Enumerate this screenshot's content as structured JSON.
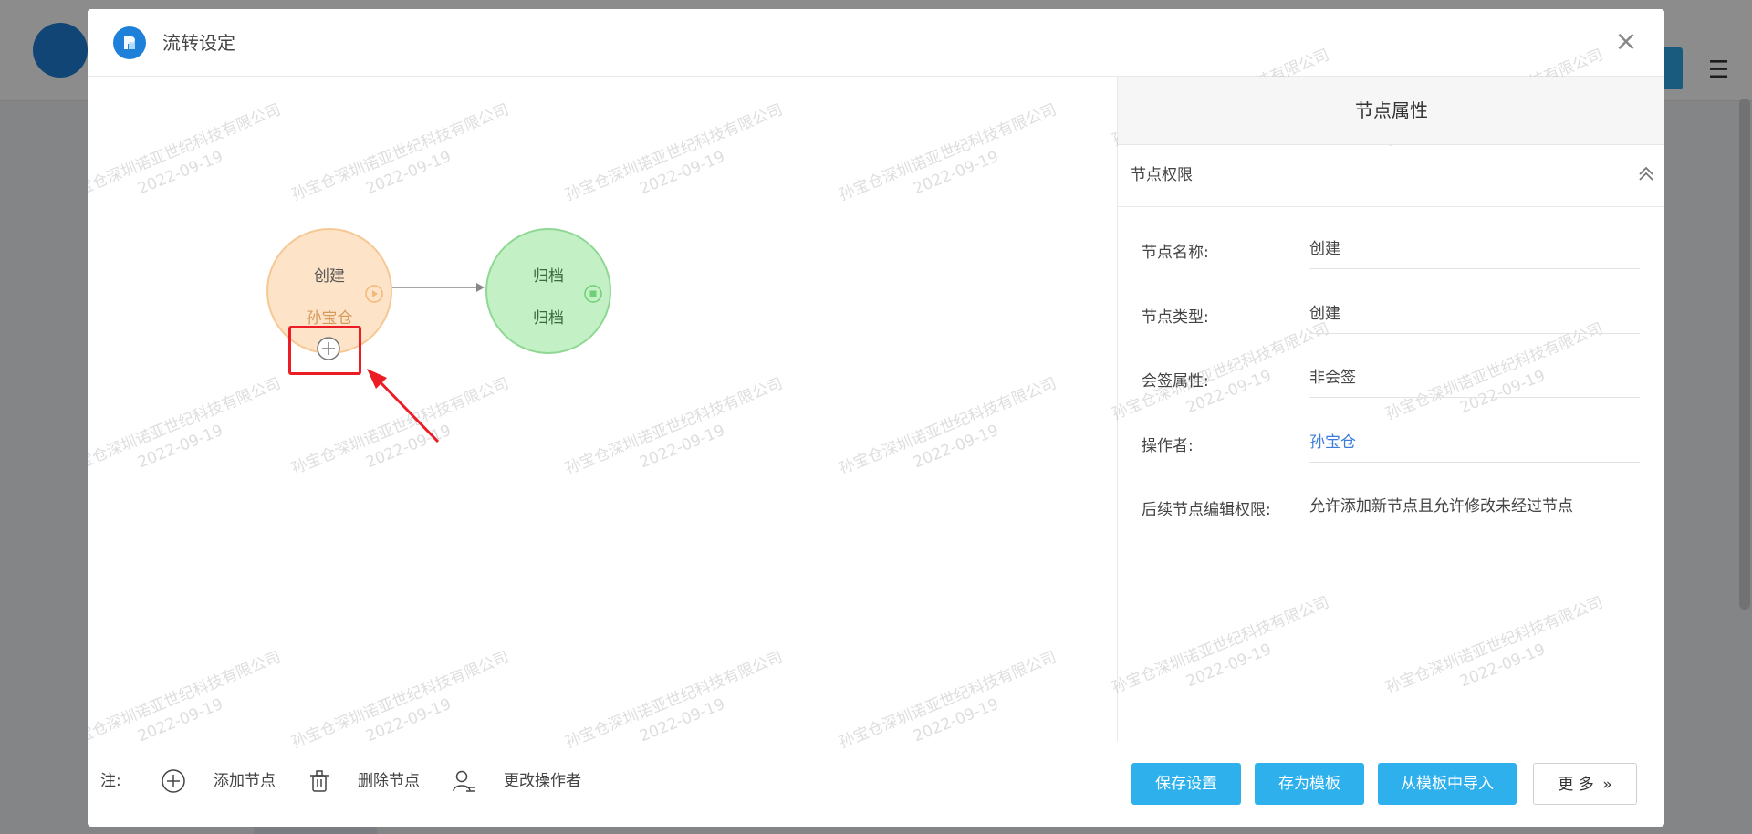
{
  "modal": {
    "title": "流转设定",
    "close_label": "×"
  },
  "watermark": {
    "line1": "孙宝仓深圳诺亚世纪科技有限公司",
    "line2": "2022-09-19"
  },
  "flow": {
    "start_node": {
      "title": "创建",
      "operator": "孙宝仓"
    },
    "end_node": {
      "title": "归档",
      "operator": "归档"
    }
  },
  "legend": {
    "note_label": "注:",
    "add_node": "添加节点",
    "delete_node": "删除节点",
    "change_operator": "更改操作者"
  },
  "panel": {
    "title": "节点属性",
    "section_title": "节点权限",
    "rows": [
      {
        "label": "节点名称:",
        "value": "创建"
      },
      {
        "label": "节点类型:",
        "value": "创建"
      },
      {
        "label": "会签属性:",
        "value": "非会签"
      },
      {
        "label": "操作者:",
        "value": "孙宝仓"
      },
      {
        "label": "后续节点编辑权限:",
        "value": "允许添加新节点且允许修改未经过节点"
      }
    ]
  },
  "footer": {
    "save_settings": "保存设置",
    "save_as_template": "存为模板",
    "import_from_template": "从模板中导入",
    "more": "更 多"
  },
  "colors": {
    "primary": "#2db0ec",
    "start_node_fill": "#fde3c7",
    "end_node_fill": "#c4f0c6",
    "highlight": "#ec1c24",
    "link": "#3b7dd8"
  }
}
